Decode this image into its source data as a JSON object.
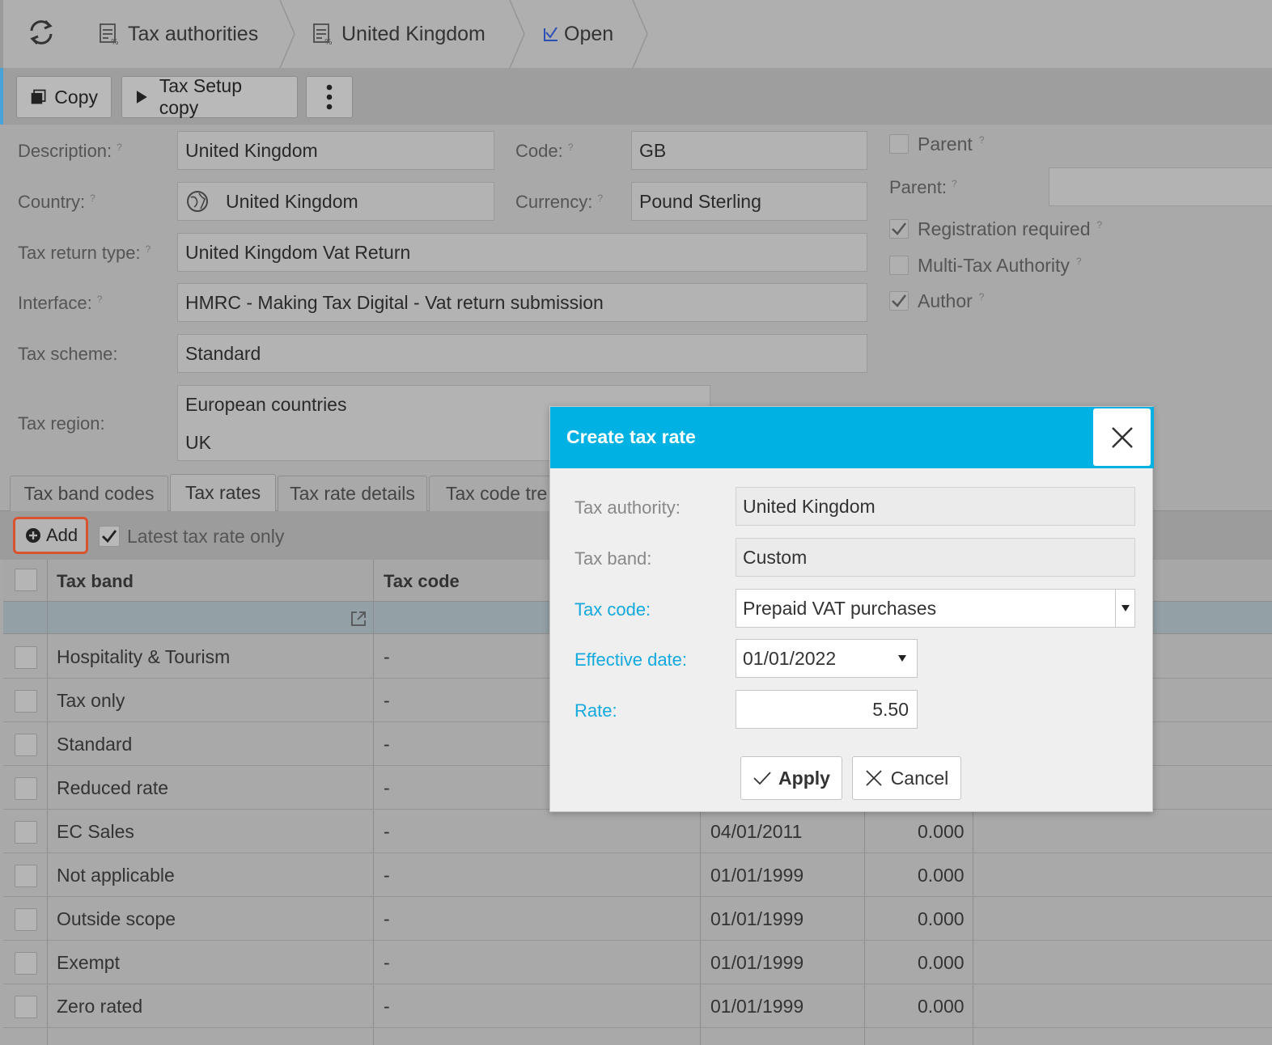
{
  "breadcrumb": {
    "items": [
      {
        "label": "Tax authorities",
        "icon": "document-table-icon"
      },
      {
        "label": "United Kingdom",
        "icon": "document-table-icon"
      },
      {
        "label": "Open",
        "icon": "check-icon"
      }
    ]
  },
  "toolbar": {
    "copy_label": "Copy",
    "tax_setup_copy_label": "Tax Setup copy"
  },
  "form": {
    "description_label": "Description:",
    "description_value": "United Kingdom",
    "code_label": "Code:",
    "code_value": "GB",
    "country_label": "Country:",
    "country_value": "United Kingdom",
    "currency_label": "Currency:",
    "currency_value": "Pound Sterling",
    "tax_return_type_label": "Tax return type:",
    "tax_return_type_value": "United Kingdom Vat Return",
    "interface_label": "Interface:",
    "interface_value": "HMRC - Making Tax Digital - Vat return submission",
    "tax_scheme_label": "Tax scheme:",
    "tax_scheme_value": "Standard",
    "tax_region_label": "Tax region:",
    "tax_region_values": [
      "European countries",
      "UK"
    ],
    "help_mark": "?"
  },
  "side": {
    "parent_checkbox_label": "Parent",
    "parent_label": "Parent:",
    "registration_required_label": "Registration required",
    "multi_tax_authority_label": "Multi-Tax Authority",
    "author_label": "Author",
    "registration_required": true,
    "multi_tax_authority": false,
    "author": true,
    "parent": false
  },
  "tabs": [
    {
      "label": "Tax band codes",
      "active": false
    },
    {
      "label": "Tax rates",
      "active": true
    },
    {
      "label": "Tax rate details",
      "active": false
    },
    {
      "label": "Tax code tre",
      "active": false
    }
  ],
  "grid_toolbar": {
    "add_label": "Add",
    "latest_label": "Latest tax rate only",
    "latest_checked": true
  },
  "grid": {
    "columns": [
      "Tax band",
      "Tax code"
    ],
    "rows": [
      {
        "band": "Hospitality & Tourism",
        "code": "-",
        "date": "",
        "rate": ""
      },
      {
        "band": "Tax only",
        "code": "-",
        "date": "",
        "rate": ""
      },
      {
        "band": "Standard",
        "code": "-",
        "date": "",
        "rate": ""
      },
      {
        "band": "Reduced rate",
        "code": "-",
        "date": "",
        "rate": ""
      },
      {
        "band": "EC Sales",
        "code": "-",
        "date": "04/01/2011",
        "rate": "0.000"
      },
      {
        "band": "Not applicable",
        "code": "-",
        "date": "01/01/1999",
        "rate": "0.000"
      },
      {
        "band": "Outside scope",
        "code": "-",
        "date": "01/01/1999",
        "rate": "0.000"
      },
      {
        "band": "Exempt",
        "code": "-",
        "date": "01/01/1999",
        "rate": "0.000"
      },
      {
        "band": "Zero rated",
        "code": "-",
        "date": "01/01/1999",
        "rate": "0.000"
      }
    ]
  },
  "modal": {
    "title": "Create tax rate",
    "tax_authority_label": "Tax authority:",
    "tax_authority_value": "United Kingdom",
    "tax_band_label": "Tax band:",
    "tax_band_value": "Custom",
    "tax_code_label": "Tax code:",
    "tax_code_value": "Prepaid VAT purchases",
    "effective_date_label": "Effective date:",
    "effective_date_value": "01/01/2022",
    "rate_label": "Rate:",
    "rate_value": "5.50",
    "apply_label": "Apply",
    "cancel_label": "Cancel"
  },
  "colors": {
    "accent": "#00b2e3",
    "required_label": "#13a9de",
    "highlight_border": "#d9532f"
  }
}
